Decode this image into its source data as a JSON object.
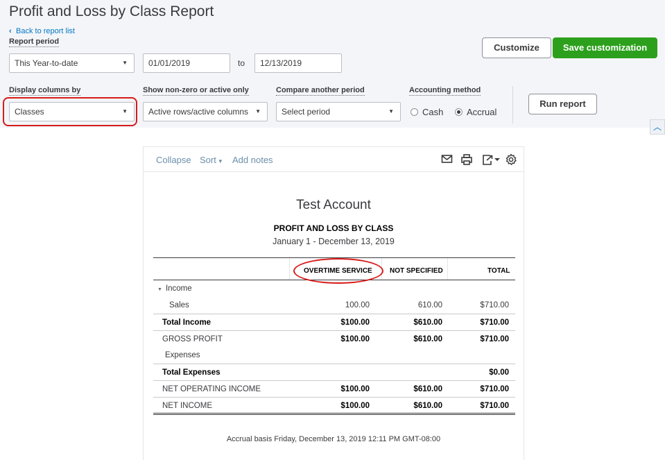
{
  "header": {
    "title": "Profit and Loss by Class Report",
    "back_link": "Back to report list"
  },
  "report_period": {
    "label": "Report period",
    "selected": "This Year-to-date",
    "from_date": "01/01/2019",
    "to_label": "to",
    "to_date": "12/13/2019"
  },
  "buttons": {
    "customize": "Customize",
    "save_customization": "Save customization",
    "run_report": "Run report"
  },
  "display_columns": {
    "label": "Display columns by",
    "selected": "Classes"
  },
  "show_nonzero": {
    "label": "Show non-zero or active only",
    "selected": "Active rows/active columns"
  },
  "compare_period": {
    "label": "Compare another period",
    "placeholder": "Select period"
  },
  "accounting_method": {
    "label": "Accounting method",
    "options": [
      "Cash",
      "Accrual"
    ],
    "selected": "Accrual"
  },
  "toolbar": {
    "collapse": "Collapse",
    "sort": "Sort",
    "add_notes": "Add notes",
    "icons": [
      "email-icon",
      "print-icon",
      "export-icon",
      "settings-gear-icon"
    ]
  },
  "report": {
    "company": "Test Account",
    "title": "PROFIT AND LOSS BY CLASS",
    "date_range": "January 1 - December 13, 2019",
    "columns": [
      "OVERTIME SERVICE",
      "NOT SPECIFIED",
      "TOTAL"
    ],
    "rows": [
      {
        "label": "Income",
        "values": [
          "",
          "",
          ""
        ]
      },
      {
        "label": "Sales",
        "values": [
          "100.00",
          "610.00",
          "$710.00"
        ]
      },
      {
        "label": "Total Income",
        "values": [
          "$100.00",
          "$610.00",
          "$710.00"
        ]
      },
      {
        "label": "GROSS PROFIT",
        "values": [
          "$100.00",
          "$610.00",
          "$710.00"
        ]
      },
      {
        "label": "Expenses",
        "values": [
          "",
          "",
          ""
        ]
      },
      {
        "label": "Total Expenses",
        "values": [
          "",
          "",
          "$0.00"
        ]
      },
      {
        "label": "NET OPERATING INCOME",
        "values": [
          "$100.00",
          "$610.00",
          "$710.00"
        ]
      },
      {
        "label": "NET INCOME",
        "values": [
          "$100.00",
          "$610.00",
          "$710.00"
        ]
      }
    ],
    "footer": "Accrual basis  Friday, December 13, 2019  12:11 PM GMT-08:00"
  },
  "colors": {
    "accent_green": "#2ca01c",
    "link_blue": "#0077c5",
    "highlight_red": "#d71a1a"
  }
}
